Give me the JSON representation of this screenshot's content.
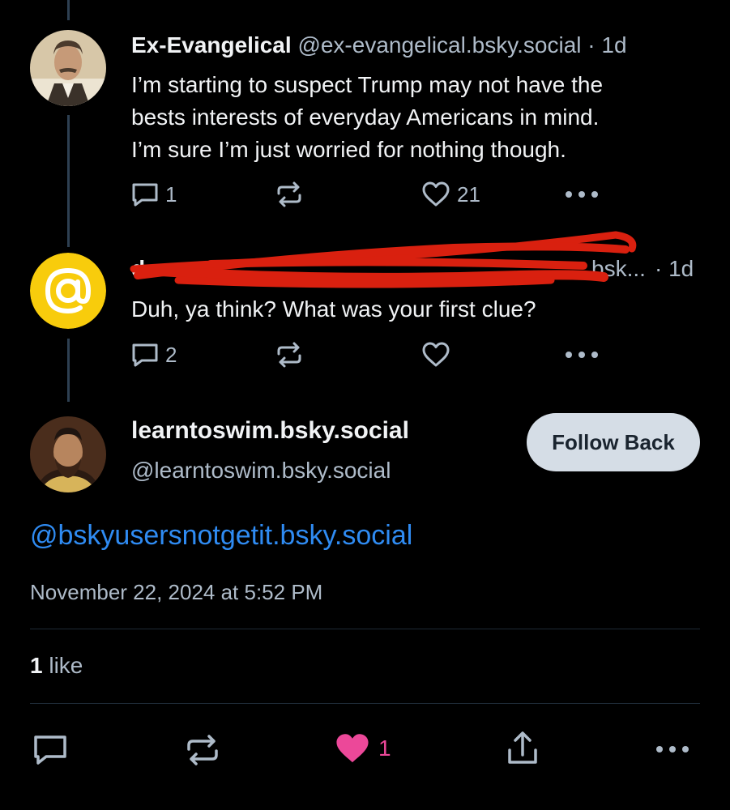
{
  "colors": {
    "background": "#000000",
    "thread_line": "#2e4052",
    "muted_text": "#aebbc9",
    "link": "#2f8bf2",
    "like_active": "#ec4899",
    "redaction": "#d9200f",
    "follow_button_bg": "#d5dde6"
  },
  "post1": {
    "author_name": "Ex-Evangelical",
    "handle": "@ex-evangelical.bsky.social",
    "separator": "·",
    "time": "1d",
    "text_lines": [
      "I’m starting to suspect Trump may not have the",
      "bests interests of everyday Americans in mind.",
      "I’m sure I’m just worried for nothing though."
    ],
    "reply_count": "1",
    "like_count": "21",
    "icons": [
      "comment-icon",
      "repost-icon",
      "heart-icon",
      "more-icon"
    ]
  },
  "post2": {
    "author_name_partial": "d",
    "handle_partial": "bsk...",
    "separator": "·",
    "time": "1d",
    "text": "Duh, ya think? What was your first clue?",
    "reply_count": "2",
    "icons": [
      "comment-icon",
      "repost-icon",
      "heart-icon",
      "more-icon"
    ]
  },
  "main_post": {
    "author_name": "learntoswim.bsky.social",
    "handle": "@learntoswim.bsky.social",
    "follow_button_label": "Follow Back",
    "mention": "@bskyusersnotgetit.bsky.social",
    "timestamp": "November 22, 2024 at 5:52 PM",
    "likes_count": "1",
    "likes_label": "like",
    "bottom_like_count": "1",
    "icons": [
      "comment-icon",
      "repost-icon",
      "heart-filled-icon",
      "share-icon",
      "more-icon"
    ]
  }
}
